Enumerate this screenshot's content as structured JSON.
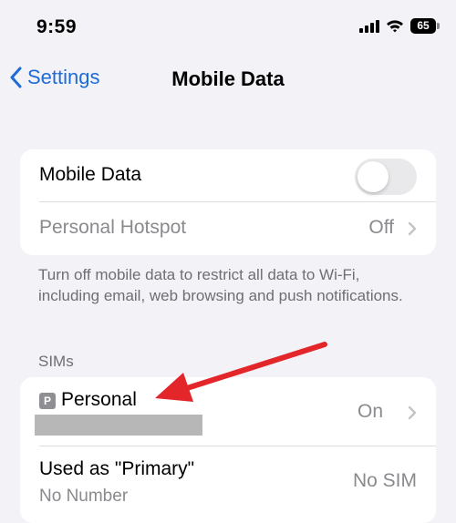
{
  "status_bar": {
    "time": "9:59",
    "battery": "65",
    "icons": [
      "signal-icon",
      "wifi-icon",
      "battery-icon"
    ]
  },
  "nav": {
    "back_label": "Settings",
    "title": "Mobile Data"
  },
  "mobile_group": {
    "mobile_data_label": "Mobile Data",
    "mobile_data_toggle": "off",
    "hotspot_label": "Personal Hotspot",
    "hotspot_value": "Off"
  },
  "footer_text": "Turn off mobile data to restrict all data to Wi-Fi, including email, web browsing and push notifications.",
  "sims": {
    "header": "SIMs",
    "personal": {
      "badge": "P",
      "label": "Personal",
      "value": "On"
    },
    "primary": {
      "label": "Used as \"Primary\"",
      "sublabel": "No Number",
      "value": "No SIM"
    }
  },
  "colors": {
    "accent": "#1e6bd6",
    "annotation_arrow": "#e3262a",
    "background": "#f2f2f7"
  }
}
